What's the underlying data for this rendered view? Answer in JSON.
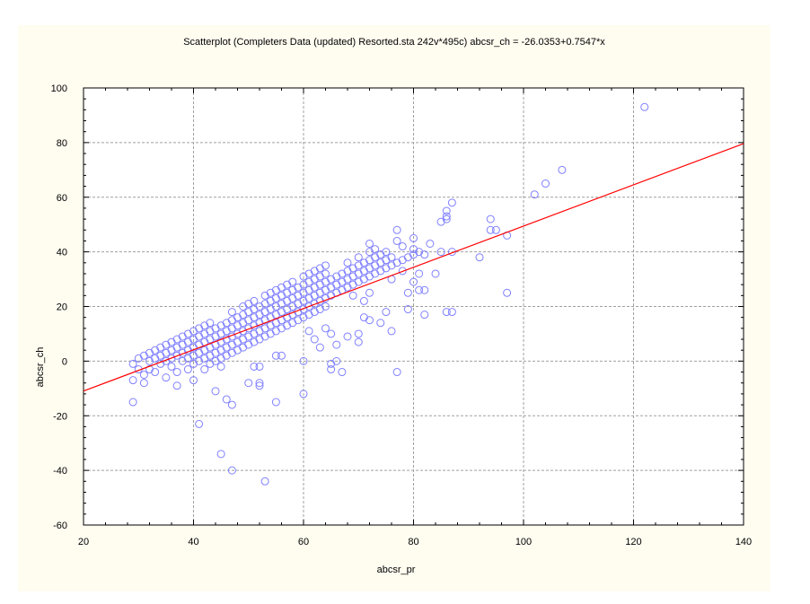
{
  "colors": {
    "background": "#ffffff",
    "panel": "#fffcf0",
    "plot_area": "#ffffff",
    "points": "#8080ff",
    "fit_line": "#ff0000",
    "grid": "#a0a0a0"
  },
  "chart_data": {
    "type": "scatter",
    "title": "Scatterplot (Completers Data (updated) Resorted.sta 242v*495c) abcsr_ch = -26.0353+0.7547*x",
    "xlabel": "abcsr_pr",
    "ylabel": "abcsr_ch",
    "xlim": [
      20,
      140
    ],
    "ylim": [
      -60,
      100
    ],
    "x_ticks": [
      "20",
      "40",
      "60",
      "80",
      "100",
      "120",
      "140"
    ],
    "y_ticks": [
      "100",
      "80",
      "60",
      "40",
      "20",
      "0",
      "-20",
      "-40",
      "-60"
    ],
    "grid": true,
    "fit": {
      "intercept": -26.0353,
      "slope": 0.7547
    },
    "points": [
      [
        29,
        -1
      ],
      [
        29,
        -7
      ],
      [
        29,
        -15
      ],
      [
        30,
        -3
      ],
      [
        30,
        1
      ],
      [
        31,
        -5
      ],
      [
        31,
        -8
      ],
      [
        31,
        2
      ],
      [
        32,
        0
      ],
      [
        32,
        -3
      ],
      [
        32,
        3
      ],
      [
        33,
        1
      ],
      [
        33,
        4
      ],
      [
        33,
        -4
      ],
      [
        34,
        2
      ],
      [
        34,
        5
      ],
      [
        34,
        -1
      ],
      [
        35,
        3
      ],
      [
        35,
        6
      ],
      [
        35,
        0
      ],
      [
        35,
        -6
      ],
      [
        36,
        1
      ],
      [
        36,
        4
      ],
      [
        36,
        7
      ],
      [
        36,
        -2
      ],
      [
        37,
        2
      ],
      [
        37,
        5
      ],
      [
        37,
        8
      ],
      [
        37,
        -4
      ],
      [
        37,
        -9
      ],
      [
        38,
        0
      ],
      [
        38,
        3
      ],
      [
        38,
        6
      ],
      [
        38,
        9
      ],
      [
        39,
        1
      ],
      [
        39,
        4
      ],
      [
        39,
        7
      ],
      [
        39,
        10
      ],
      [
        39,
        -3
      ],
      [
        40,
        2
      ],
      [
        40,
        5
      ],
      [
        40,
        8
      ],
      [
        40,
        11
      ],
      [
        40,
        -1
      ],
      [
        40,
        -7
      ],
      [
        41,
        3
      ],
      [
        41,
        6
      ],
      [
        41,
        9
      ],
      [
        41,
        12
      ],
      [
        41,
        0
      ],
      [
        41,
        -23
      ],
      [
        42,
        1
      ],
      [
        42,
        4
      ],
      [
        42,
        7
      ],
      [
        42,
        10
      ],
      [
        42,
        13
      ],
      [
        42,
        -3
      ],
      [
        43,
        2
      ],
      [
        43,
        5
      ],
      [
        43,
        8
      ],
      [
        43,
        11
      ],
      [
        43,
        14
      ],
      [
        43,
        -1
      ],
      [
        44,
        3
      ],
      [
        44,
        6
      ],
      [
        44,
        9
      ],
      [
        44,
        12
      ],
      [
        44,
        0
      ],
      [
        44,
        -11
      ],
      [
        45,
        4
      ],
      [
        45,
        7
      ],
      [
        45,
        10
      ],
      [
        45,
        13
      ],
      [
        45,
        1
      ],
      [
        45,
        -2
      ],
      [
        45,
        -34
      ],
      [
        46,
        5
      ],
      [
        46,
        8
      ],
      [
        46,
        11
      ],
      [
        46,
        14
      ],
      [
        46,
        2
      ],
      [
        46,
        -14
      ],
      [
        47,
        6
      ],
      [
        47,
        9
      ],
      [
        47,
        12
      ],
      [
        47,
        15
      ],
      [
        47,
        18
      ],
      [
        47,
        3
      ],
      [
        47,
        -16
      ],
      [
        47,
        -40
      ],
      [
        48,
        7
      ],
      [
        48,
        10
      ],
      [
        48,
        13
      ],
      [
        48,
        16
      ],
      [
        48,
        4
      ],
      [
        49,
        8
      ],
      [
        49,
        11
      ],
      [
        49,
        14
      ],
      [
        49,
        17
      ],
      [
        49,
        20
      ],
      [
        49,
        5
      ],
      [
        50,
        9
      ],
      [
        50,
        12
      ],
      [
        50,
        15
      ],
      [
        50,
        18
      ],
      [
        50,
        21
      ],
      [
        50,
        6
      ],
      [
        50,
        -8
      ],
      [
        51,
        10
      ],
      [
        51,
        13
      ],
      [
        51,
        16
      ],
      [
        51,
        19
      ],
      [
        51,
        22
      ],
      [
        51,
        7
      ],
      [
        51,
        -2
      ],
      [
        52,
        11
      ],
      [
        52,
        14
      ],
      [
        52,
        17
      ],
      [
        52,
        20
      ],
      [
        52,
        8
      ],
      [
        52,
        -2
      ],
      [
        52,
        -8
      ],
      [
        52,
        -9
      ],
      [
        53,
        12
      ],
      [
        53,
        15
      ],
      [
        53,
        18
      ],
      [
        53,
        21
      ],
      [
        53,
        24
      ],
      [
        53,
        9
      ],
      [
        53,
        -44
      ],
      [
        54,
        13
      ],
      [
        54,
        16
      ],
      [
        54,
        19
      ],
      [
        54,
        22
      ],
      [
        54,
        25
      ],
      [
        54,
        10
      ],
      [
        55,
        14
      ],
      [
        55,
        17
      ],
      [
        55,
        20
      ],
      [
        55,
        23
      ],
      [
        55,
        26
      ],
      [
        55,
        11
      ],
      [
        55,
        2
      ],
      [
        55,
        -15
      ],
      [
        56,
        15
      ],
      [
        56,
        18
      ],
      [
        56,
        21
      ],
      [
        56,
        24
      ],
      [
        56,
        27
      ],
      [
        56,
        12
      ],
      [
        56,
        2
      ],
      [
        57,
        16
      ],
      [
        57,
        19
      ],
      [
        57,
        22
      ],
      [
        57,
        25
      ],
      [
        57,
        28
      ],
      [
        57,
        13
      ],
      [
        58,
        17
      ],
      [
        58,
        20
      ],
      [
        58,
        23
      ],
      [
        58,
        26
      ],
      [
        58,
        29
      ],
      [
        58,
        14
      ],
      [
        59,
        18
      ],
      [
        59,
        21
      ],
      [
        59,
        24
      ],
      [
        59,
        27
      ],
      [
        59,
        15
      ],
      [
        60,
        19
      ],
      [
        60,
        22
      ],
      [
        60,
        25
      ],
      [
        60,
        28
      ],
      [
        60,
        31
      ],
      [
        60,
        16
      ],
      [
        60,
        0
      ],
      [
        60,
        -12
      ],
      [
        61,
        20
      ],
      [
        61,
        23
      ],
      [
        61,
        26
      ],
      [
        61,
        29
      ],
      [
        61,
        32
      ],
      [
        61,
        17
      ],
      [
        61,
        11
      ],
      [
        62,
        21
      ],
      [
        62,
        24
      ],
      [
        62,
        27
      ],
      [
        62,
        30
      ],
      [
        62,
        33
      ],
      [
        62,
        18
      ],
      [
        62,
        8
      ],
      [
        63,
        22
      ],
      [
        63,
        25
      ],
      [
        63,
        28
      ],
      [
        63,
        31
      ],
      [
        63,
        34
      ],
      [
        63,
        19
      ],
      [
        63,
        5
      ],
      [
        64,
        23
      ],
      [
        64,
        26
      ],
      [
        64,
        29
      ],
      [
        64,
        32
      ],
      [
        64,
        35
      ],
      [
        64,
        20
      ],
      [
        64,
        12
      ],
      [
        65,
        24
      ],
      [
        65,
        27
      ],
      [
        65,
        30
      ],
      [
        65,
        10
      ],
      [
        65,
        -1
      ],
      [
        65,
        -3
      ],
      [
        66,
        25
      ],
      [
        66,
        28
      ],
      [
        66,
        31
      ],
      [
        66,
        6
      ],
      [
        66,
        0
      ],
      [
        67,
        26
      ],
      [
        67,
        29
      ],
      [
        67,
        32
      ],
      [
        67,
        -4
      ],
      [
        68,
        27
      ],
      [
        68,
        30
      ],
      [
        68,
        33
      ],
      [
        68,
        36
      ],
      [
        68,
        9
      ],
      [
        69,
        28
      ],
      [
        69,
        31
      ],
      [
        69,
        34
      ],
      [
        69,
        24
      ],
      [
        70,
        29
      ],
      [
        70,
        32
      ],
      [
        70,
        35
      ],
      [
        70,
        38
      ],
      [
        70,
        7
      ],
      [
        70,
        10
      ],
      [
        71,
        30
      ],
      [
        71,
        33
      ],
      [
        71,
        36
      ],
      [
        71,
        16
      ],
      [
        71,
        22
      ],
      [
        72,
        31
      ],
      [
        72,
        34
      ],
      [
        72,
        37
      ],
      [
        72,
        40
      ],
      [
        72,
        43
      ],
      [
        72,
        15
      ],
      [
        72,
        25
      ],
      [
        73,
        32
      ],
      [
        73,
        35
      ],
      [
        73,
        38
      ],
      [
        73,
        41
      ],
      [
        74,
        33
      ],
      [
        74,
        36
      ],
      [
        74,
        39
      ],
      [
        74,
        14
      ],
      [
        75,
        34
      ],
      [
        75,
        37
      ],
      [
        75,
        40
      ],
      [
        75,
        18
      ],
      [
        76,
        35
      ],
      [
        76,
        38
      ],
      [
        76,
        30
      ],
      [
        76,
        11
      ],
      [
        77,
        36
      ],
      [
        77,
        44
      ],
      [
        77,
        48
      ],
      [
        77,
        -4
      ],
      [
        78,
        37
      ],
      [
        78,
        33
      ],
      [
        78,
        42
      ],
      [
        79,
        38
      ],
      [
        79,
        25
      ],
      [
        79,
        19
      ],
      [
        80,
        39
      ],
      [
        80,
        45
      ],
      [
        80,
        41
      ],
      [
        80,
        29
      ],
      [
        81,
        40
      ],
      [
        81,
        26
      ],
      [
        81,
        32
      ],
      [
        82,
        26
      ],
      [
        82,
        17
      ],
      [
        82,
        39
      ],
      [
        83,
        43
      ],
      [
        84,
        32
      ],
      [
        85,
        40
      ],
      [
        85,
        51
      ],
      [
        86,
        53
      ],
      [
        86,
        52
      ],
      [
        86,
        55
      ],
      [
        86,
        18
      ],
      [
        87,
        58
      ],
      [
        87,
        40
      ],
      [
        87,
        18
      ],
      [
        92,
        38
      ],
      [
        94,
        52
      ],
      [
        94,
        48
      ],
      [
        95,
        48
      ],
      [
        97,
        46
      ],
      [
        97,
        25
      ],
      [
        102,
        61
      ],
      [
        104,
        65
      ],
      [
        107,
        70
      ],
      [
        122,
        93
      ]
    ]
  }
}
